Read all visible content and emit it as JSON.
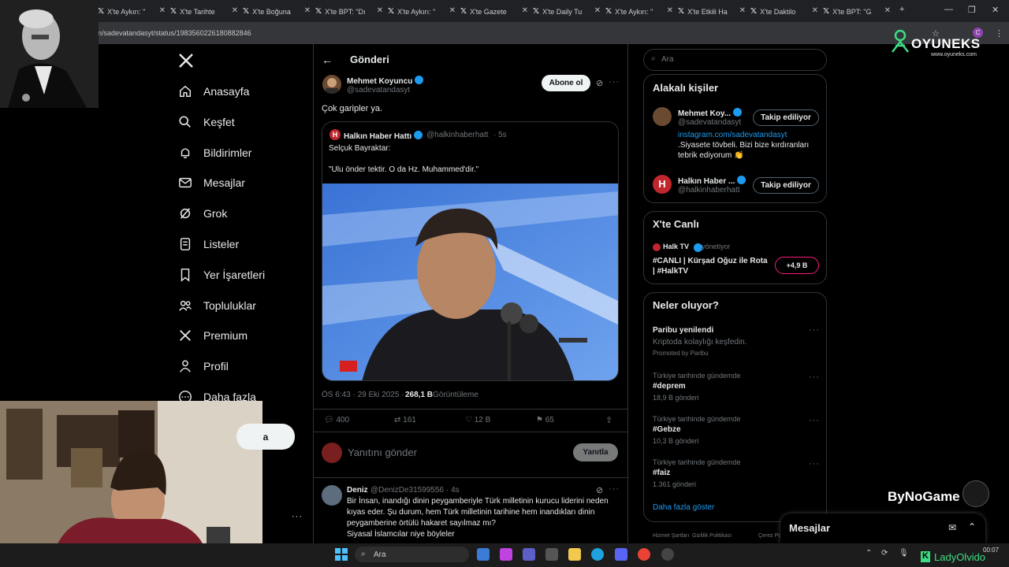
{
  "browser": {
    "tabs": [
      "X'te Aykırı: \"",
      "X'te Tarihte",
      "X'te Boğuna",
      "X'te BPT: \"Dı",
      "X'te Aykırı: \"",
      "X'te Gazete",
      "X'te Daily Tu",
      "X'te Aykırı: \"",
      "X'te Etkili Ha",
      "X'te Daktilo",
      "X'te BPT: \"G"
    ],
    "url": "n/sadevatandasyt/status/1983560226180882846",
    "new_tab": "+"
  },
  "overlay": {
    "brand": "OYUNEKS",
    "brand_url": "www.oyuneks.com",
    "watermark": "ByNoGame",
    "streamer": "LadyOlvido"
  },
  "sidebar": {
    "items": [
      {
        "label": "Anasayfa",
        "icon": "home-icon"
      },
      {
        "label": "Keşfet",
        "icon": "search-icon"
      },
      {
        "label": "Bildirimler",
        "icon": "bell-icon"
      },
      {
        "label": "Mesajlar",
        "icon": "mail-icon"
      },
      {
        "label": "Grok",
        "icon": "grok-icon"
      },
      {
        "label": "Listeler",
        "icon": "list-icon"
      },
      {
        "label": "Yer İşaretleri",
        "icon": "bookmark-icon"
      },
      {
        "label": "Topluluklar",
        "icon": "people-icon"
      },
      {
        "label": "Premium",
        "icon": "x-logo-icon"
      },
      {
        "label": "Profil",
        "icon": "user-icon"
      },
      {
        "label": "Daha fazla",
        "icon": "more-circle-icon"
      }
    ],
    "post_button_fragment": "a"
  },
  "post": {
    "header": "Gönderi",
    "author_name": "Mehmet Koyuncu",
    "author_handle": "@sadevatandasyt",
    "subscribe": "Abone ol",
    "text": "Çok garipler ya.",
    "quote": {
      "name": "Halkın Haber Hattı",
      "handle": "@halkinhaberhatt",
      "time": "· 5s",
      "line1": "Selçuk Bayraktar:",
      "line2": "\"Ulu önder tektir. O da Hz. Muhammed'dir.\""
    },
    "meta_time": "ÖS 6:43 · 29 Eki 2025 ·",
    "views_count": "268,1 B",
    "views_label": "Görüntüleme",
    "stats": {
      "replies": "400",
      "reposts": "161",
      "likes": "12 B",
      "bookmarks": "65"
    },
    "reply_placeholder": "Yanıtını gönder",
    "reply_button": "Yanıtla"
  },
  "reply": {
    "name": "Deniz",
    "handle": "@DenizDe31599556",
    "time": "· 4s",
    "lines": [
      "Bir İnsan, inandığı dinin peygamberiyle Türk milletinin kurucu liderini neden",
      "kıyas eder. Şu durum, hem Türk milletinin tarihine hem inandıkları dinin",
      "peygamberine örtülü hakaret sayılmaz mı?",
      "Siyasal İslamcılar niye böyleler"
    ]
  },
  "right": {
    "search_placeholder": "Ara",
    "related_title": "Alakalı kişiler",
    "people": [
      {
        "name": "Mehmet Koy...",
        "handle": "@sadevatandasyt",
        "button": "Takip ediliyor",
        "bio_link": "instagram.com/sadevatandasyt",
        "bio": ".Siyasete tövbeli. Bizi bize kırdıranları",
        "bio2": "tebrik ediyorum 👏"
      },
      {
        "name": "Halkın Haber ...",
        "handle": "@halkinhaberhatt",
        "button": "Takip ediliyor"
      }
    ],
    "live_title": "X'te Canlı",
    "live": {
      "host": "Halk TV",
      "role": "yönetiyor",
      "title1": "#CANLI | Kürşad Oğuz ile Rota",
      "title2": "| #HalkTV",
      "listeners": "+4,9 B"
    },
    "trends_title": "Neler oluyor?",
    "promo": {
      "name": "Paribu yenilendi",
      "desc": "Kriptoda kolaylığı keşfedin.",
      "promoted": "Promoted by Paribu"
    },
    "trends": [
      {
        "context": "Türkiye tarihinde gündemde",
        "name": "#deprem",
        "count": "18,9 B gönderi"
      },
      {
        "context": "Türkiye tarihinde gündemde",
        "name": "#Gebze",
        "count": "10,3 B gönderi"
      },
      {
        "context": "Türkiye tarihinde gündemde",
        "name": "#faiz",
        "count": "1.361 gönderi"
      }
    ],
    "show_more": "Daha fazla göster",
    "footer": [
      "Hizmet Şartları",
      "Gizlilik Politikası",
      "Çerez Po"
    ]
  },
  "messages_dock": {
    "title": "Mesajlar"
  },
  "taskbar": {
    "search": "Ara",
    "time": "00:07"
  }
}
